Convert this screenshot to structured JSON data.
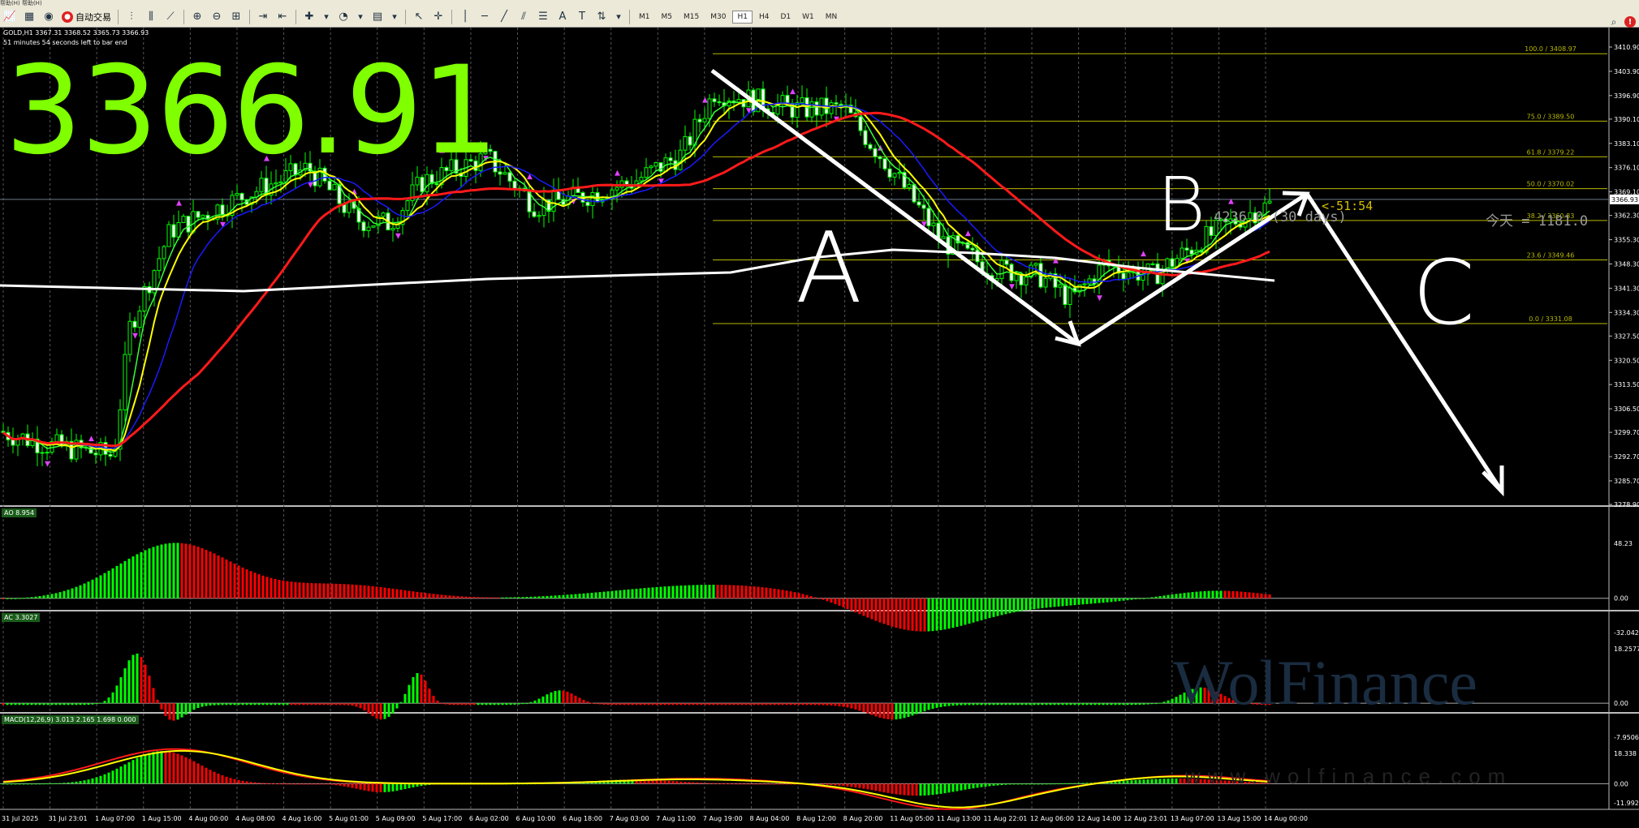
{
  "topbar": {
    "text": "帮助(H)  帮助(H)"
  },
  "toolbar": {
    "auto_trade_label": "自动交易",
    "timeframes": [
      "M1",
      "M5",
      "M15",
      "M30",
      "H1",
      "H4",
      "D1",
      "W1",
      "MN"
    ],
    "active_timeframe": "H1"
  },
  "chart": {
    "symbol_info": "GOLD,H1  3367.31 3368.52 3365.73 3366.93",
    "bar_timer": "51 minutes 54 seconds left to bar end",
    "big_price": "3366.91",
    "current_price_label": "3366.93",
    "countdown": "<-51:54",
    "count_text": "4236.0  (30 days)",
    "today_text": "今天 = 1181.0",
    "watermark_logo": "WolFinance",
    "watermark_url": "www.wolfinance.com",
    "annotations": {
      "a": "A",
      "b": "B",
      "c": "C"
    }
  },
  "chart_data": {
    "type": "candlestick",
    "symbol": "GOLD",
    "timeframe": "H1",
    "ohlc": {
      "open": 3367.31,
      "high": 3368.52,
      "low": 3365.73,
      "close": 3366.93
    },
    "price_axis": [
      "3410.90",
      "3403.90",
      "3396.90",
      "3390.10",
      "3383.10",
      "3376.10",
      "3369.10",
      "3362.30",
      "3355.30",
      "3348.30",
      "3341.30",
      "3334.30",
      "3327.50",
      "3320.50",
      "3313.50",
      "3306.50",
      "3299.70",
      "3292.70",
      "3285.70",
      "3278.90"
    ],
    "time_axis": [
      "31 Jul 2025",
      "31 Jul 23:01",
      "1 Aug 07:00",
      "1 Aug 15:00",
      "4 Aug 00:00",
      "4 Aug 08:00",
      "4 Aug 16:00",
      "5 Aug 01:00",
      "5 Aug 09:00",
      "5 Aug 17:00",
      "6 Aug 02:00",
      "6 Aug 10:00",
      "6 Aug 18:00",
      "7 Aug 03:00",
      "7 Aug 11:00",
      "7 Aug 19:00",
      "8 Aug 04:00",
      "8 Aug 12:00",
      "8 Aug 20:00",
      "11 Aug 05:00",
      "11 Aug 13:00",
      "11 Aug 22:01",
      "12 Aug 06:00",
      "12 Aug 14:00",
      "12 Aug 23:01",
      "13 Aug 07:00",
      "13 Aug 15:00",
      "14 Aug 00:00"
    ],
    "fibonacci": [
      {
        "level": "100.0",
        "price": "3408.97"
      },
      {
        "level": "75.0",
        "price": "3389.50"
      },
      {
        "level": "61.8",
        "price": "3379.22"
      },
      {
        "level": "50.0",
        "price": "3370.02"
      },
      {
        "level": "38.2",
        "price": "3360.83"
      },
      {
        "level": "23.6",
        "price": "3349.46"
      },
      {
        "level": "0.0",
        "price": "3331.08"
      }
    ],
    "indicators": {
      "ao": {
        "label": "AO 8.954",
        "max": "48.23",
        "zero": "0.00",
        "min": "-32.042"
      },
      "ac": {
        "label": "AC 3.3027",
        "max": "18.2577",
        "zero": "0.00",
        "min": "-7.9506"
      },
      "macd": {
        "label": "MACD(12,26,9) 3.013 2.165 1.698 0.000",
        "max": "18.338",
        "zero": "0.00",
        "min": "-11.992"
      }
    },
    "colors": {
      "background": "#000000",
      "bull": "#00ff00",
      "bear": "#ff0000",
      "ma_red": "#ff1a1a",
      "ma_blue": "#1a1aff",
      "ma_yellow": "#ffff00",
      "ma_green": "#33ff33",
      "ma_white": "#ffffff",
      "fib": "#b8b800",
      "big_price": "#7fff00"
    }
  }
}
